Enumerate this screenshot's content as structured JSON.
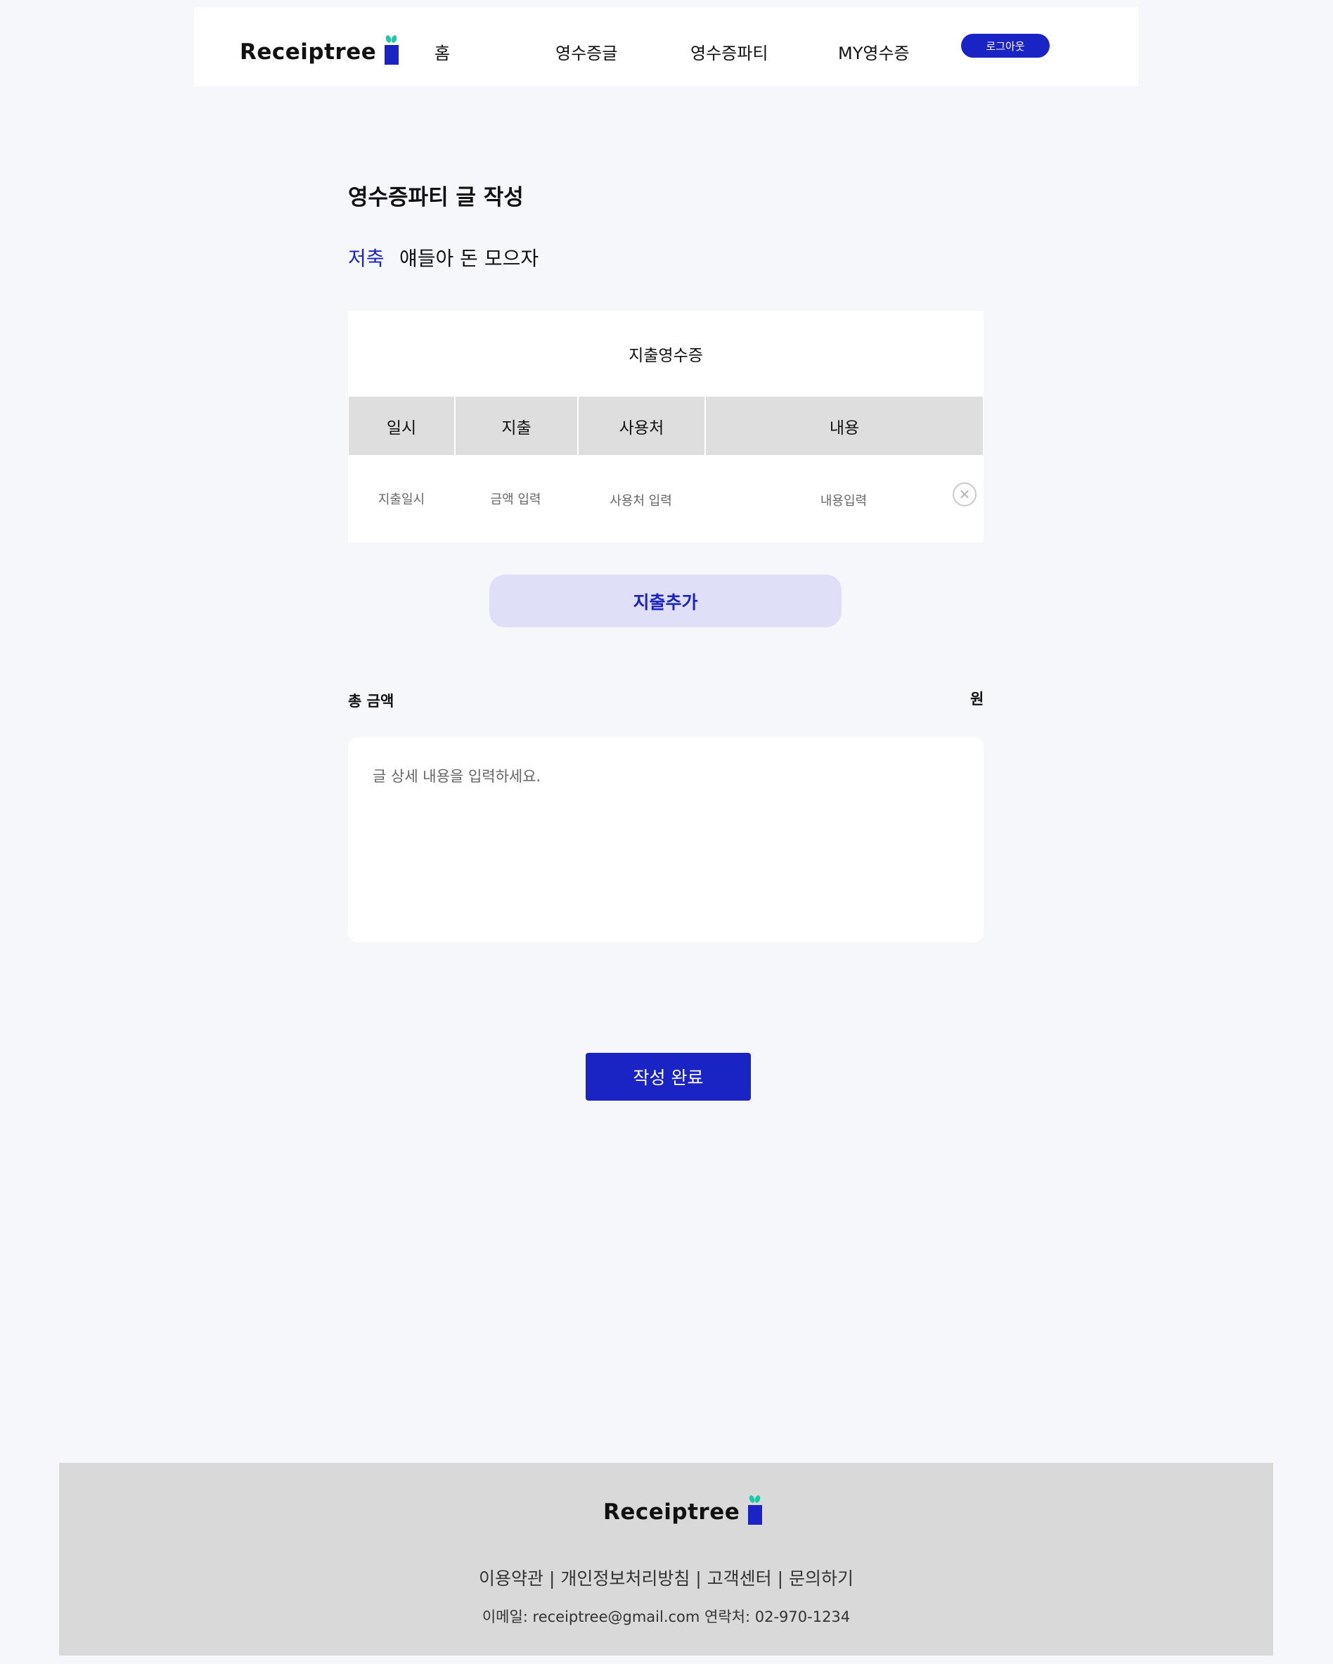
{
  "header": {
    "logo_text": "Receiptree",
    "nav": {
      "home": "홈",
      "receipt_posts": "영수증글",
      "receipt_party": "영수증파티",
      "my_receipt": "MY영수증"
    },
    "logout_label": "로그아웃"
  },
  "main": {
    "page_title": "영수증파티 글 작성",
    "post_category": "저축",
    "post_subject": "얘들아 돈 모으자",
    "receipt": {
      "title": "지출영수증",
      "columns": [
        "일시",
        "지출",
        "사용처",
        "내용"
      ],
      "row": {
        "date": "지출일시",
        "amount": "금액 입력",
        "place": "사용처 입력",
        "content": "내용입력"
      }
    },
    "add_expense_label": "지출추가",
    "total_label": "총 금액",
    "total_unit": "원",
    "detail_placeholder": "글 상세 내용을 입력하세요.",
    "submit_label": "작성 완료"
  },
  "footer": {
    "logo_text": "Receiptree",
    "links": "이용약관 | 개인정보처리방침 | 고객센터 | 문의하기",
    "contact": "이메일: receiptree@gmail.com 연락처: 02-970-1234"
  },
  "colors": {
    "accent": "#1a23c4",
    "leaf": "#1ec9a6",
    "page_bg": "#f6f7fb",
    "table_header_bg": "#dedede",
    "add_button_bg": "#dfe0f8",
    "footer_bg": "#d9d9d9"
  },
  "icons": {
    "remove_row": "close-circle-icon",
    "logo_mark": "receipt-tree-logo-icon"
  }
}
